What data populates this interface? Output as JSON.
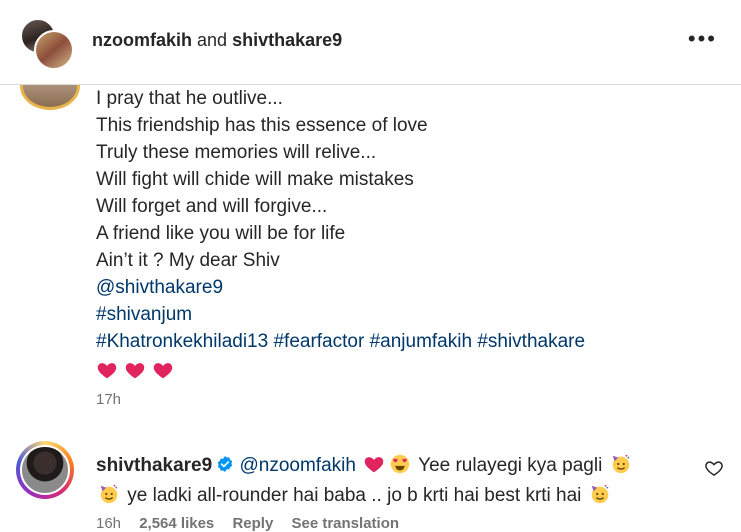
{
  "header": {
    "user1": "nzoomfakih",
    "and_text": "and",
    "user2": "shivthakare9",
    "more_icon": "more-horizontal-icon"
  },
  "caption": {
    "lines": [
      "I pray that he outlive...",
      "This friendship has this essence of love",
      "Truly these memories will relive...",
      "Will fight will chide will make mistakes",
      "Will forget and will forgive...",
      "A friend like you will be for life",
      "Ain’t it ? My dear Shiv"
    ],
    "mention": "@shivthakare9",
    "hashtag1": "#shivanjum",
    "hashtags": [
      "#Khatronkekhiladi13",
      "#fearfactor",
      "#anjumfakih",
      "#shivthakare"
    ],
    "hearts": [
      "red-heart-icon",
      "red-heart-icon",
      "red-heart-icon"
    ],
    "time": "17h"
  },
  "comment": {
    "username": "shivthakare9",
    "mention": "@nzoomfakih",
    "text1": "Yee rulayegi kya pagli",
    "text2": "ye ladki all-rounder hai baba .. jo b krti hai best krti hai",
    "time": "16h",
    "likes": "2,564 likes",
    "reply": "Reply",
    "translation": "See translation"
  },
  "colors": {
    "link": "#00376b",
    "muted": "#737373",
    "verified": "#0095f6",
    "heart": "#e0245e"
  }
}
